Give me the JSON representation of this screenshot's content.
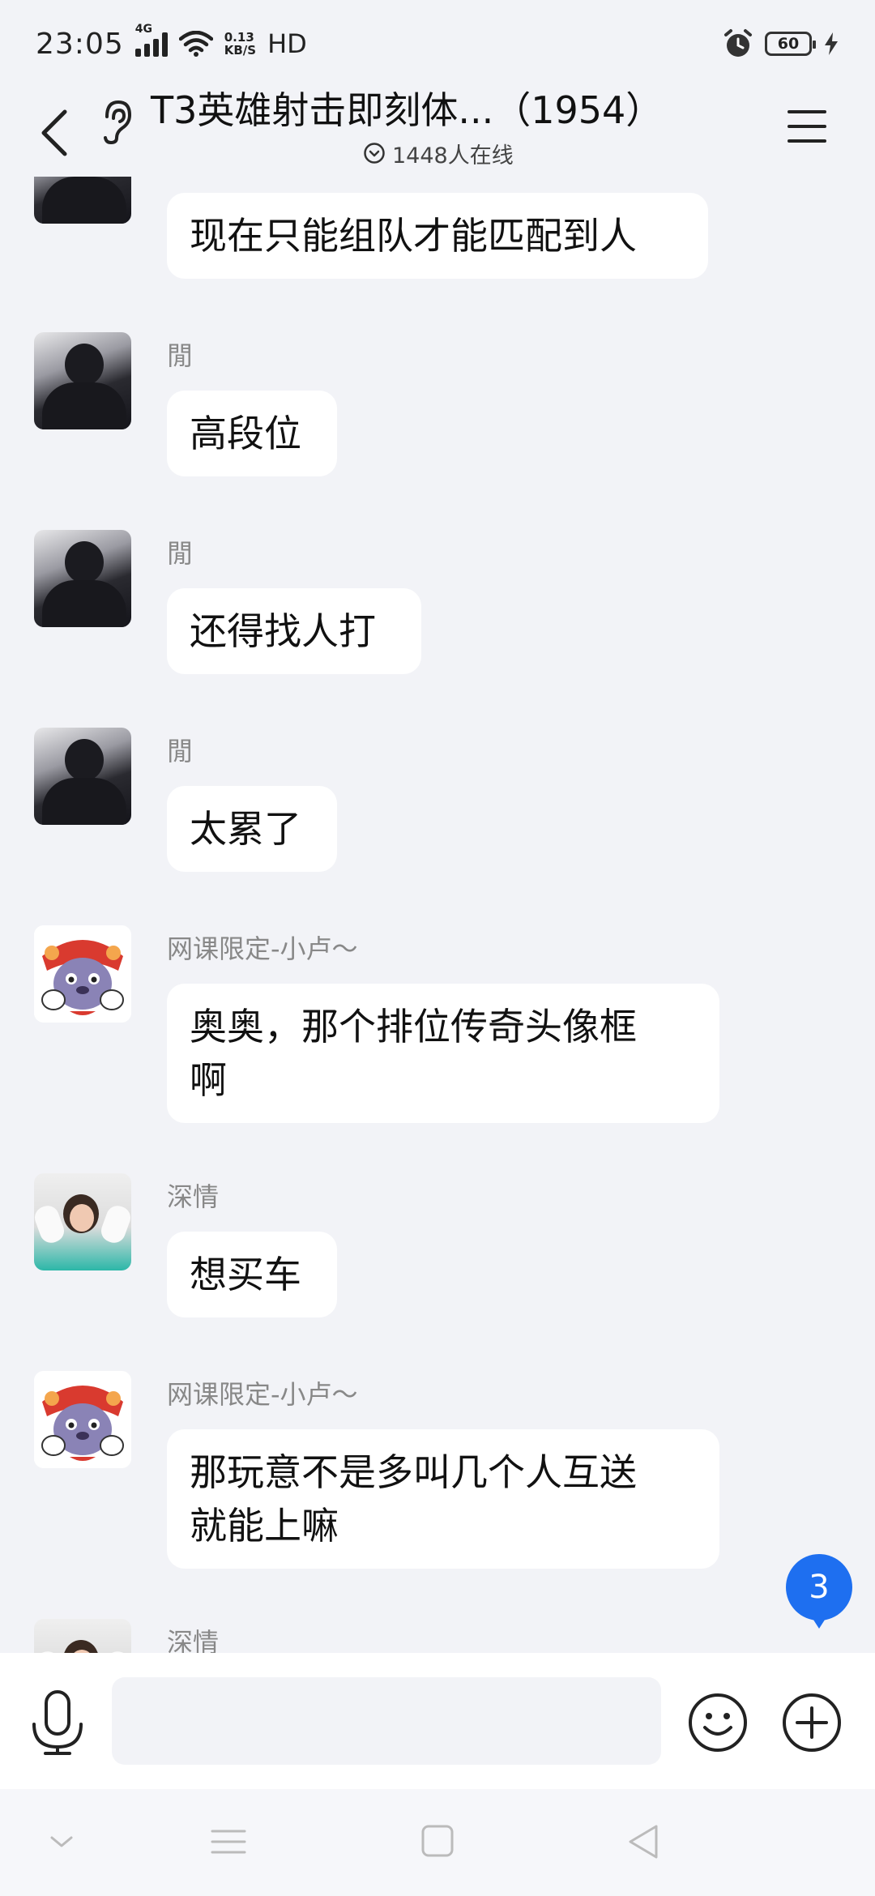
{
  "status_bar": {
    "time": "23:05",
    "network": "4G",
    "speed_value": "0.13",
    "speed_unit": "KB/S",
    "hd": "HD",
    "battery": "60"
  },
  "header": {
    "title": "T3英雄射击即刻体...（1954）",
    "online_count": "1448人在线"
  },
  "messages": [
    {
      "sender": "",
      "text": "现在只能组队才能匹配到人",
      "avatar": "dark-hoodie"
    },
    {
      "sender": "閒",
      "text": "高段位",
      "avatar": "dark-hoodie"
    },
    {
      "sender": "閒",
      "text": "还得找人打",
      "avatar": "dark-hoodie"
    },
    {
      "sender": "閒",
      "text": "太累了",
      "avatar": "dark-hoodie"
    },
    {
      "sender": "网课限定-小卢～",
      "text": "奥奥，那个排位传奇头像框啊",
      "line1": "奥奥，那个排位传奇头像框",
      "line2": "啊",
      "avatar": "lion-dance"
    },
    {
      "sender": "深情",
      "text": "想买车",
      "avatar": "girl-lying"
    },
    {
      "sender": "网课限定-小卢～",
      "text": "那玩意不是多叫几个人互送就能上嘛",
      "line1": "那玩意不是多叫几个人互送",
      "line2": "就能上嘛",
      "avatar": "lion-dance"
    },
    {
      "sender": "深情",
      "text": "",
      "avatar": "girl-lying"
    }
  ],
  "unread_count": "3",
  "input": {
    "value": "",
    "placeholder": ""
  },
  "colors": {
    "accent": "#1e6ff0",
    "background": "#f2f3f7",
    "bubble": "#ffffff"
  },
  "icons": [
    "back-arrow-icon",
    "ear-icon",
    "menu-icon",
    "online-check-icon",
    "voice-icon",
    "emoji-icon",
    "plus-icon",
    "nav-down-icon",
    "nav-menu-icon",
    "nav-home-icon",
    "nav-back-icon"
  ]
}
